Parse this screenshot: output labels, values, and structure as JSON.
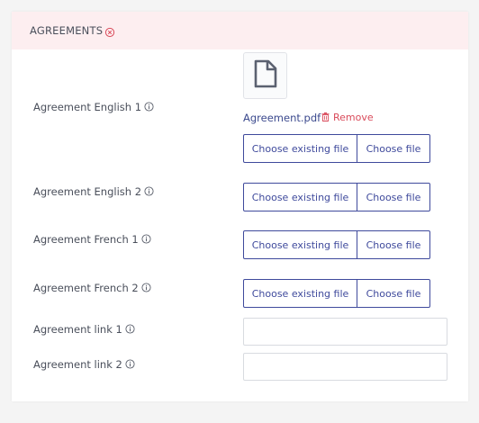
{
  "section": {
    "title": "AGREEMENTS",
    "collapse_icon": "close-circle-icon",
    "accent_color": "#d94a5a",
    "header_bg": "#fdeef0"
  },
  "fields": {
    "agreement_english_1": {
      "label": "Agreement English 1",
      "file_icon": "document-icon",
      "file_name": "Agreement.pdf",
      "remove_label": "Remove",
      "choose_existing_label": "Choose existing file",
      "choose_file_label": "Choose file"
    },
    "agreement_english_2": {
      "label": "Agreement English 2",
      "choose_existing_label": "Choose existing file",
      "choose_file_label": "Choose file"
    },
    "agreement_french_1": {
      "label": "Agreement French 1",
      "choose_existing_label": "Choose existing file",
      "choose_file_label": "Choose file"
    },
    "agreement_french_2": {
      "label": "Agreement French 2",
      "choose_existing_label": "Choose existing file",
      "choose_file_label": "Choose file"
    },
    "agreement_link_1": {
      "label": "Agreement link 1",
      "value": ""
    },
    "agreement_link_2": {
      "label": "Agreement link 2",
      "value": ""
    }
  },
  "colors": {
    "primary": "#3f4a9c",
    "link": "#3c4a8e",
    "danger": "#d94a5a"
  }
}
